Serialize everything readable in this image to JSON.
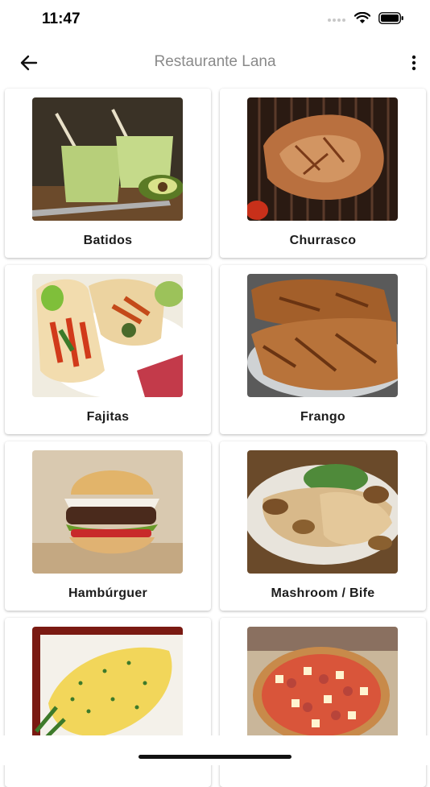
{
  "status_bar": {
    "time": "11:47"
  },
  "app_bar": {
    "title": "Restaurante Lana"
  },
  "categories": [
    {
      "label": "Batidos"
    },
    {
      "label": "Churrasco"
    },
    {
      "label": "Fajitas"
    },
    {
      "label": "Frango"
    },
    {
      "label": "Hambúrguer"
    },
    {
      "label": "Mashroom / Bife"
    },
    {
      "label": ""
    },
    {
      "label": ""
    }
  ]
}
